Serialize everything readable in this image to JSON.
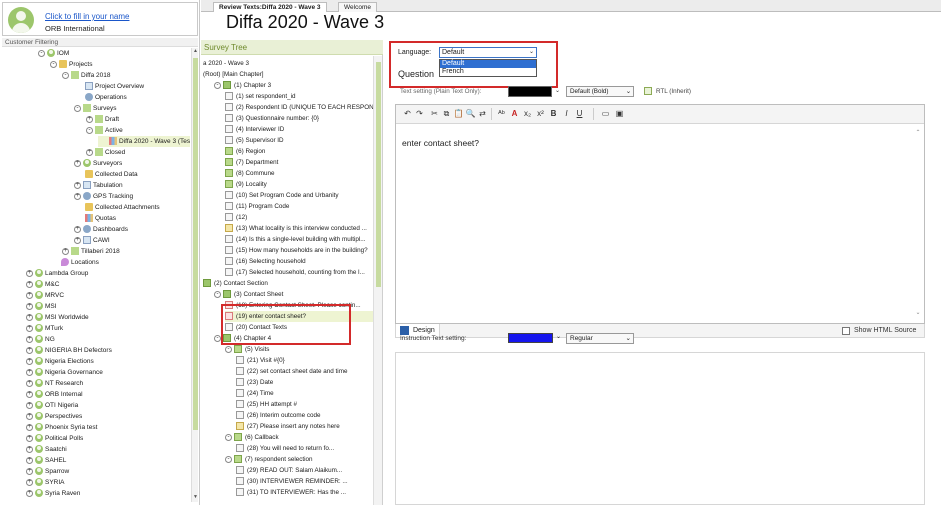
{
  "user": {
    "link_text": "Click to fill in your name",
    "org": "ORB International"
  },
  "left_panel": {
    "filter_title": "Customer Filtering",
    "tree": [
      {
        "label": "IOM",
        "indent": 1,
        "icon": "user",
        "exp": "-"
      },
      {
        "label": "Projects",
        "indent": 2,
        "icon": "folder",
        "exp": "-"
      },
      {
        "label": "Diffa 2018",
        "indent": 3,
        "icon": "check",
        "exp": "-"
      },
      {
        "label": "Project Overview",
        "indent": 4,
        "icon": "doc",
        "exp": ""
      },
      {
        "label": "Operations",
        "indent": 4,
        "icon": "gear",
        "exp": ""
      },
      {
        "label": "Surveys",
        "indent": 4,
        "icon": "check",
        "exp": "-"
      },
      {
        "label": "Draft",
        "indent": 5,
        "icon": "check",
        "exp": "+"
      },
      {
        "label": "Active",
        "indent": 5,
        "icon": "check",
        "exp": "-"
      },
      {
        "label": "Diffa 2020 - Wave 3 (Test)",
        "indent": 6,
        "icon": "multi",
        "exp": "",
        "selected": true
      },
      {
        "label": "Closed",
        "indent": 5,
        "icon": "check",
        "exp": "+"
      },
      {
        "label": "Surveyors",
        "indent": 4,
        "icon": "user",
        "exp": "+"
      },
      {
        "label": "Collected Data",
        "indent": 4,
        "icon": "folder",
        "exp": ""
      },
      {
        "label": "Tabulation",
        "indent": 4,
        "icon": "doc",
        "exp": "+"
      },
      {
        "label": "GPS Tracking",
        "indent": 4,
        "icon": "gear",
        "exp": "+"
      },
      {
        "label": "Collected Attachments",
        "indent": 4,
        "icon": "folder",
        "exp": ""
      },
      {
        "label": "Quotas",
        "indent": 4,
        "icon": "multi",
        "exp": ""
      },
      {
        "label": "Dashboards",
        "indent": 4,
        "icon": "gear",
        "exp": "+"
      },
      {
        "label": "CAWI",
        "indent": 4,
        "icon": "doc",
        "exp": "+"
      },
      {
        "label": "Tillaberi 2018",
        "indent": 3,
        "icon": "check",
        "exp": "+"
      },
      {
        "label": "Locations",
        "indent": 2,
        "icon": "loc",
        "exp": ""
      },
      {
        "label": "Lambda Group",
        "indent": 0,
        "icon": "user",
        "exp": "+"
      },
      {
        "label": "M&C",
        "indent": 0,
        "icon": "user",
        "exp": "+"
      },
      {
        "label": "MRVC",
        "indent": 0,
        "icon": "user",
        "exp": "+"
      },
      {
        "label": "MSI",
        "indent": 0,
        "icon": "user",
        "exp": "+"
      },
      {
        "label": "MSI Worldwide",
        "indent": 0,
        "icon": "user",
        "exp": "+"
      },
      {
        "label": "MTurk",
        "indent": 0,
        "icon": "user",
        "exp": "+"
      },
      {
        "label": "NG",
        "indent": 0,
        "icon": "user",
        "exp": "+"
      },
      {
        "label": "NIGERIA BH Defectors",
        "indent": 0,
        "icon": "user",
        "exp": "+"
      },
      {
        "label": "Nigeria Elections",
        "indent": 0,
        "icon": "user",
        "exp": "+"
      },
      {
        "label": "Nigeria Governance",
        "indent": 0,
        "icon": "user",
        "exp": "+"
      },
      {
        "label": "NT Research",
        "indent": 0,
        "icon": "user",
        "exp": "+"
      },
      {
        "label": "ORB Internal",
        "indent": 0,
        "icon": "user",
        "exp": "+"
      },
      {
        "label": "OTI Nigeria",
        "indent": 0,
        "icon": "user",
        "exp": "+"
      },
      {
        "label": "Perspectives",
        "indent": 0,
        "icon": "user",
        "exp": "+"
      },
      {
        "label": "Phoenix Syria test",
        "indent": 0,
        "icon": "user",
        "exp": "+"
      },
      {
        "label": "Political Polls",
        "indent": 0,
        "icon": "user",
        "exp": "+"
      },
      {
        "label": "Saatchi",
        "indent": 0,
        "icon": "user",
        "exp": "+"
      },
      {
        "label": "SAHEL",
        "indent": 0,
        "icon": "user",
        "exp": "+"
      },
      {
        "label": "Sparrow",
        "indent": 0,
        "icon": "user",
        "exp": "+"
      },
      {
        "label": "SYRIA",
        "indent": 0,
        "icon": "user",
        "exp": "+"
      },
      {
        "label": "Syria Raven",
        "indent": 0,
        "icon": "user",
        "exp": "+"
      }
    ]
  },
  "tabs": [
    "Review Texts:Diffa 2020 - Wave 3",
    "Welcome"
  ],
  "page_title": "Diffa 2020 - Wave 3",
  "survey_tree": {
    "header": "Survey Tree",
    "nodes": [
      {
        "label": "a 2020 - Wave 3",
        "indent": 0,
        "icon": ""
      },
      {
        "label": "(Root) [Main Chapter]",
        "indent": 0,
        "icon": ""
      },
      {
        "label": "(1) Chapter 3",
        "indent": 1,
        "icon": "chap",
        "exp": "-"
      },
      {
        "label": "(1) set respondent_id",
        "indent": 2,
        "icon": "q"
      },
      {
        "label": "(2) Respondent ID (UNIQUE TO EACH RESPON...",
        "indent": 2,
        "icon": "q"
      },
      {
        "label": "(3) Questionnaire number: {0}",
        "indent": 2,
        "icon": "q"
      },
      {
        "label": "(4) Interviewer ID",
        "indent": 2,
        "icon": "q"
      },
      {
        "label": "(5) Supervisor ID",
        "indent": 2,
        "icon": "q"
      },
      {
        "label": "(6) Region",
        "indent": 2,
        "icon": "sec"
      },
      {
        "label": "(7) Department",
        "indent": 2,
        "icon": "sec"
      },
      {
        "label": "(8) Commune",
        "indent": 2,
        "icon": "sec"
      },
      {
        "label": "(9) Locality",
        "indent": 2,
        "icon": "sec"
      },
      {
        "label": "(10) Set Program Code and Urbanity",
        "indent": 2,
        "icon": "q"
      },
      {
        "label": "(11) Program Code",
        "indent": 2,
        "icon": "q"
      },
      {
        "label": "(12)",
        "indent": 2,
        "icon": "q"
      },
      {
        "label": "(13) What locality is this interview conducted ...",
        "indent": 2,
        "icon": "edit"
      },
      {
        "label": "(14) Is this a single-level building with multipl...",
        "indent": 2,
        "icon": "q"
      },
      {
        "label": "(15) How many households are in the building?",
        "indent": 2,
        "icon": "q"
      },
      {
        "label": "(16) Selecting household",
        "indent": 2,
        "icon": "q"
      },
      {
        "label": "(17) Selected household, counting from the l...",
        "indent": 2,
        "icon": "q"
      },
      {
        "label": "(2) Contact Section",
        "indent": 0,
        "icon": "chap"
      },
      {
        "label": "(3) Contact Sheet",
        "indent": 1,
        "icon": "chap",
        "exp": "-"
      },
      {
        "label": "(18) Entering Contact Sheet. Please contin...",
        "indent": 2,
        "icon": "red"
      },
      {
        "label": "(19) enter contact sheet?",
        "indent": 2,
        "icon": "red",
        "selected": true
      },
      {
        "label": "(20) Contact Texts",
        "indent": 2,
        "icon": "q"
      },
      {
        "label": "(4) Chapter 4",
        "indent": 1,
        "icon": "chap",
        "exp": "-"
      },
      {
        "label": "(5) Visits",
        "indent": 2,
        "icon": "sec",
        "exp": "-"
      },
      {
        "label": "(21) Visit #{0}",
        "indent": 3,
        "icon": "q"
      },
      {
        "label": "(22) set contact sheet date and time",
        "indent": 3,
        "icon": "q"
      },
      {
        "label": "(23) Date",
        "indent": 3,
        "icon": "q"
      },
      {
        "label": "(24) Time",
        "indent": 3,
        "icon": "q"
      },
      {
        "label": "(25) HH attempt #",
        "indent": 3,
        "icon": "q"
      },
      {
        "label": "(26) Interim outcome code",
        "indent": 3,
        "icon": "q"
      },
      {
        "label": "(27) Please insert any notes here",
        "indent": 3,
        "icon": "edit"
      },
      {
        "label": "(6) Callback",
        "indent": 2,
        "icon": "sec",
        "exp": "-"
      },
      {
        "label": "(28) You will need to return fo...",
        "indent": 3,
        "icon": "q"
      },
      {
        "label": "(7) respondent selection",
        "indent": 2,
        "icon": "sec",
        "exp": "-"
      },
      {
        "label": "(29) READ OUT: Salam Alaikum...",
        "indent": 3,
        "icon": "q"
      },
      {
        "label": "(30) INTERVIEWER REMINDER: ...",
        "indent": 3,
        "icon": "q"
      },
      {
        "label": "(31) TO INTERVIEWER: Has the ...",
        "indent": 3,
        "icon": "q"
      }
    ]
  },
  "editor": {
    "language_label": "Language:",
    "language_value": "Default",
    "language_options": [
      "Default",
      "French"
    ],
    "question_label": "Question",
    "text_setting_label": "Text setting (Plain Text Only):",
    "font_value": "Default (Bold)",
    "rtl_label": "RTL (Inherit)",
    "content": "enter contact sheet?",
    "design_tab": "Design",
    "show_html_label": "Show HTML Source",
    "instruction_label": "Instruction Text setting:",
    "instruction_style": "Regular",
    "text_color": "#000000",
    "instruction_color": "#1515ee"
  }
}
